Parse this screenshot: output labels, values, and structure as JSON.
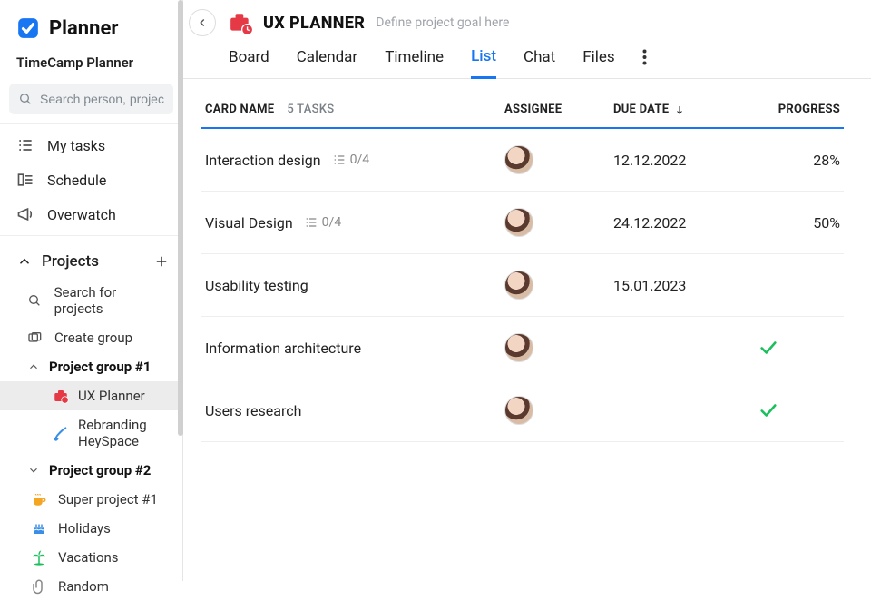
{
  "app": {
    "name": "Planner",
    "workspace": "TimeCamp Planner",
    "search_placeholder": "Search person, project or task"
  },
  "nav": {
    "my_tasks": "My tasks",
    "schedule": "Schedule",
    "overwatch": "Overwatch"
  },
  "projects_section": {
    "title": "Projects",
    "search": "Search for projects",
    "create": "Create group",
    "groups": [
      {
        "name": "Project group #1",
        "expanded": true,
        "projects": [
          {
            "name": "UX Planner",
            "icon": "briefcase-red",
            "active": true
          },
          {
            "name": "Rebranding HeySpace",
            "icon": "brush-blue",
            "active": false
          }
        ]
      },
      {
        "name": "Project group #2",
        "expanded": false,
        "projects": []
      }
    ],
    "loose_projects": [
      {
        "name": "Super project #1",
        "icon": "coffee-orange"
      },
      {
        "name": "Holidays",
        "icon": "cake-blue"
      },
      {
        "name": "Vacations",
        "icon": "palm-green"
      },
      {
        "name": "Random",
        "icon": "attach-grey"
      }
    ]
  },
  "project_header": {
    "title": "UX PLANNER",
    "goal_placeholder": "Define project goal here"
  },
  "tabs": {
    "board": "Board",
    "calendar": "Calendar",
    "timeline": "Timeline",
    "list": "List",
    "chat": "Chat",
    "files": "Files",
    "active": "list"
  },
  "table": {
    "columns": {
      "card_name": "CARD NAME",
      "assignee": "ASSIGNEE",
      "due_date": "DUE DATE",
      "progress": "PROGRESS"
    },
    "task_count_label": "5 TASKS",
    "rows": [
      {
        "name": "Interaction design",
        "subtasks": "0/4",
        "due": "12.12.2022",
        "progress": "28%",
        "done": false
      },
      {
        "name": "Visual Design",
        "subtasks": "0/4",
        "due": "24.12.2022",
        "progress": "50%",
        "done": false
      },
      {
        "name": "Usability testing",
        "subtasks": "",
        "due": "15.01.2023",
        "progress": "",
        "done": false
      },
      {
        "name": "Information architecture",
        "subtasks": "",
        "due": "",
        "progress": "",
        "done": true
      },
      {
        "name": "Users research",
        "subtasks": "",
        "due": "",
        "progress": "",
        "done": true
      }
    ]
  }
}
